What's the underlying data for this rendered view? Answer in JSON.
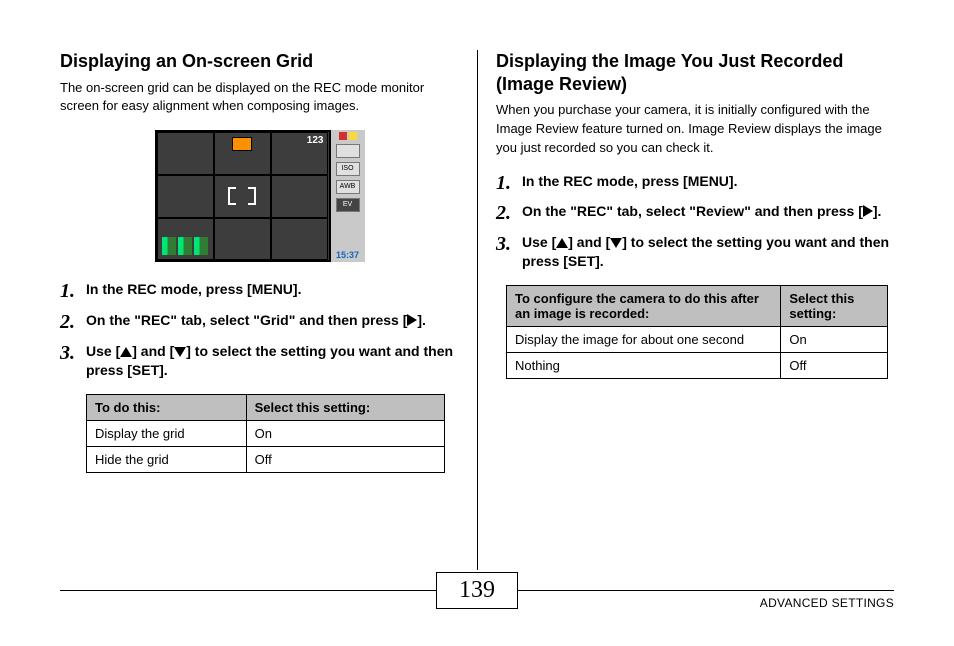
{
  "footer": {
    "page_number": "139",
    "section": "ADVANCED SETTINGS"
  },
  "left": {
    "heading": "Displaying an On-screen Grid",
    "intro": "The on-screen grid can be displayed on the REC mode monitor screen for easy alignment when composing images.",
    "screen": {
      "counter": "123",
      "side_labels": [
        "ISO",
        "AWB",
        "EV"
      ],
      "time": "15:37"
    },
    "steps": {
      "s1": "In the REC mode, press [MENU].",
      "s2_a": "On the \"REC\" tab, select \"Grid\" and then press [",
      "s2_b": "].",
      "s3_a": "Use [",
      "s3_b": "] and [",
      "s3_c": "] to select the setting you want and then press [SET]."
    },
    "table": {
      "h1": "To do this:",
      "h2": "Select this setting:",
      "r1c1": "Display the grid",
      "r1c2": "On",
      "r2c1": "Hide the grid",
      "r2c2": "Off"
    }
  },
  "right": {
    "heading": "Displaying the Image You Just Recorded (Image Review)",
    "intro": "When you purchase your camera, it is initially configured with the Image Review feature turned on. Image Review displays the image you just recorded so you can check it.",
    "steps": {
      "s1": "In the REC mode, press [MENU].",
      "s2_a": "On the \"REC\" tab, select \"Review\" and then press [",
      "s2_b": "].",
      "s3_a": "Use [",
      "s3_b": "] and [",
      "s3_c": "] to select the setting you want and then press [SET]."
    },
    "table": {
      "h1": "To configure the camera to do this after an image is recorded:",
      "h2": "Select this setting:",
      "r1c1": "Display the image for about one second",
      "r1c2": "On",
      "r2c1": "Nothing",
      "r2c2": "Off"
    }
  }
}
